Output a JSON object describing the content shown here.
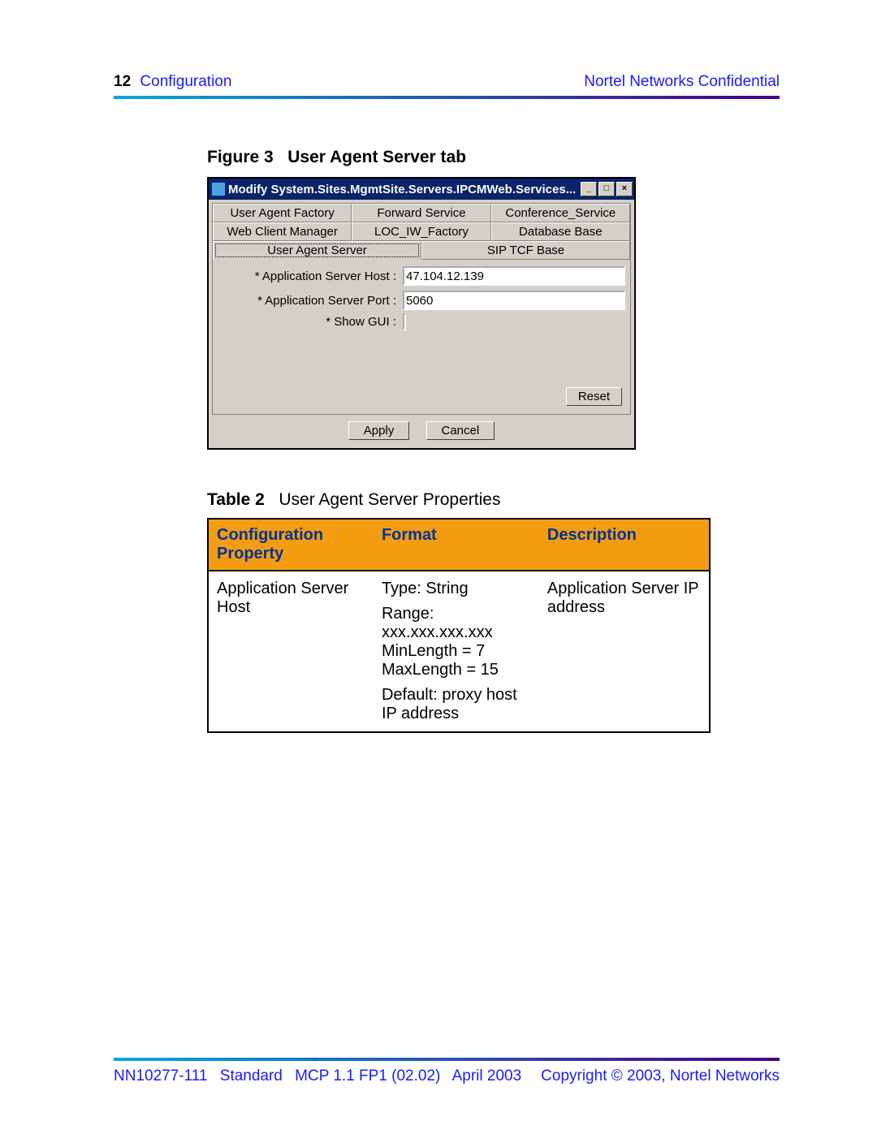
{
  "header": {
    "page_number": "12",
    "section": "Configuration",
    "confidential": "Nortel Networks Confidential"
  },
  "figure": {
    "label": "Figure 3",
    "title": "User Agent Server tab"
  },
  "dialog": {
    "title": "Modify System.Sites.MgmtSite.Servers.IPCMWeb.Services...",
    "tabs_row1": [
      "User Agent Factory",
      "Forward Service",
      "Conference_Service"
    ],
    "tabs_row2": [
      "Web Client Manager",
      "LOC_IW_Factory",
      "Database Base"
    ],
    "tabs_row3": [
      "User Agent Server",
      "SIP TCF Base"
    ],
    "fields": {
      "app_host_label": "* Application Server Host :",
      "app_host_value": "47.104.12.139",
      "app_port_label": "* Application Server Port :",
      "app_port_value": "5060",
      "show_gui_label": "* Show GUI :"
    },
    "buttons": {
      "reset": "Reset",
      "apply": "Apply",
      "cancel": "Cancel"
    }
  },
  "table": {
    "label": "Table 2",
    "title": "User Agent Server Properties",
    "headers": [
      "Configuration Property",
      "Format",
      "Description"
    ],
    "row": {
      "property": "Application Server Host",
      "format_type": "Type: String",
      "format_range_label": "Range:",
      "format_range_pattern": "xxx.xxx.xxx.xxx",
      "format_minlen": "MinLength = 7",
      "format_maxlen": "MaxLength = 15",
      "format_default": "Default: proxy host IP address",
      "description": "Application Server IP address"
    }
  },
  "footer": {
    "doc_id": "NN10277-111",
    "standard": "Standard",
    "release": "MCP 1.1 FP1 (02.02)",
    "date": "April 2003",
    "copyright": "Copyright © 2003, Nortel Networks"
  }
}
